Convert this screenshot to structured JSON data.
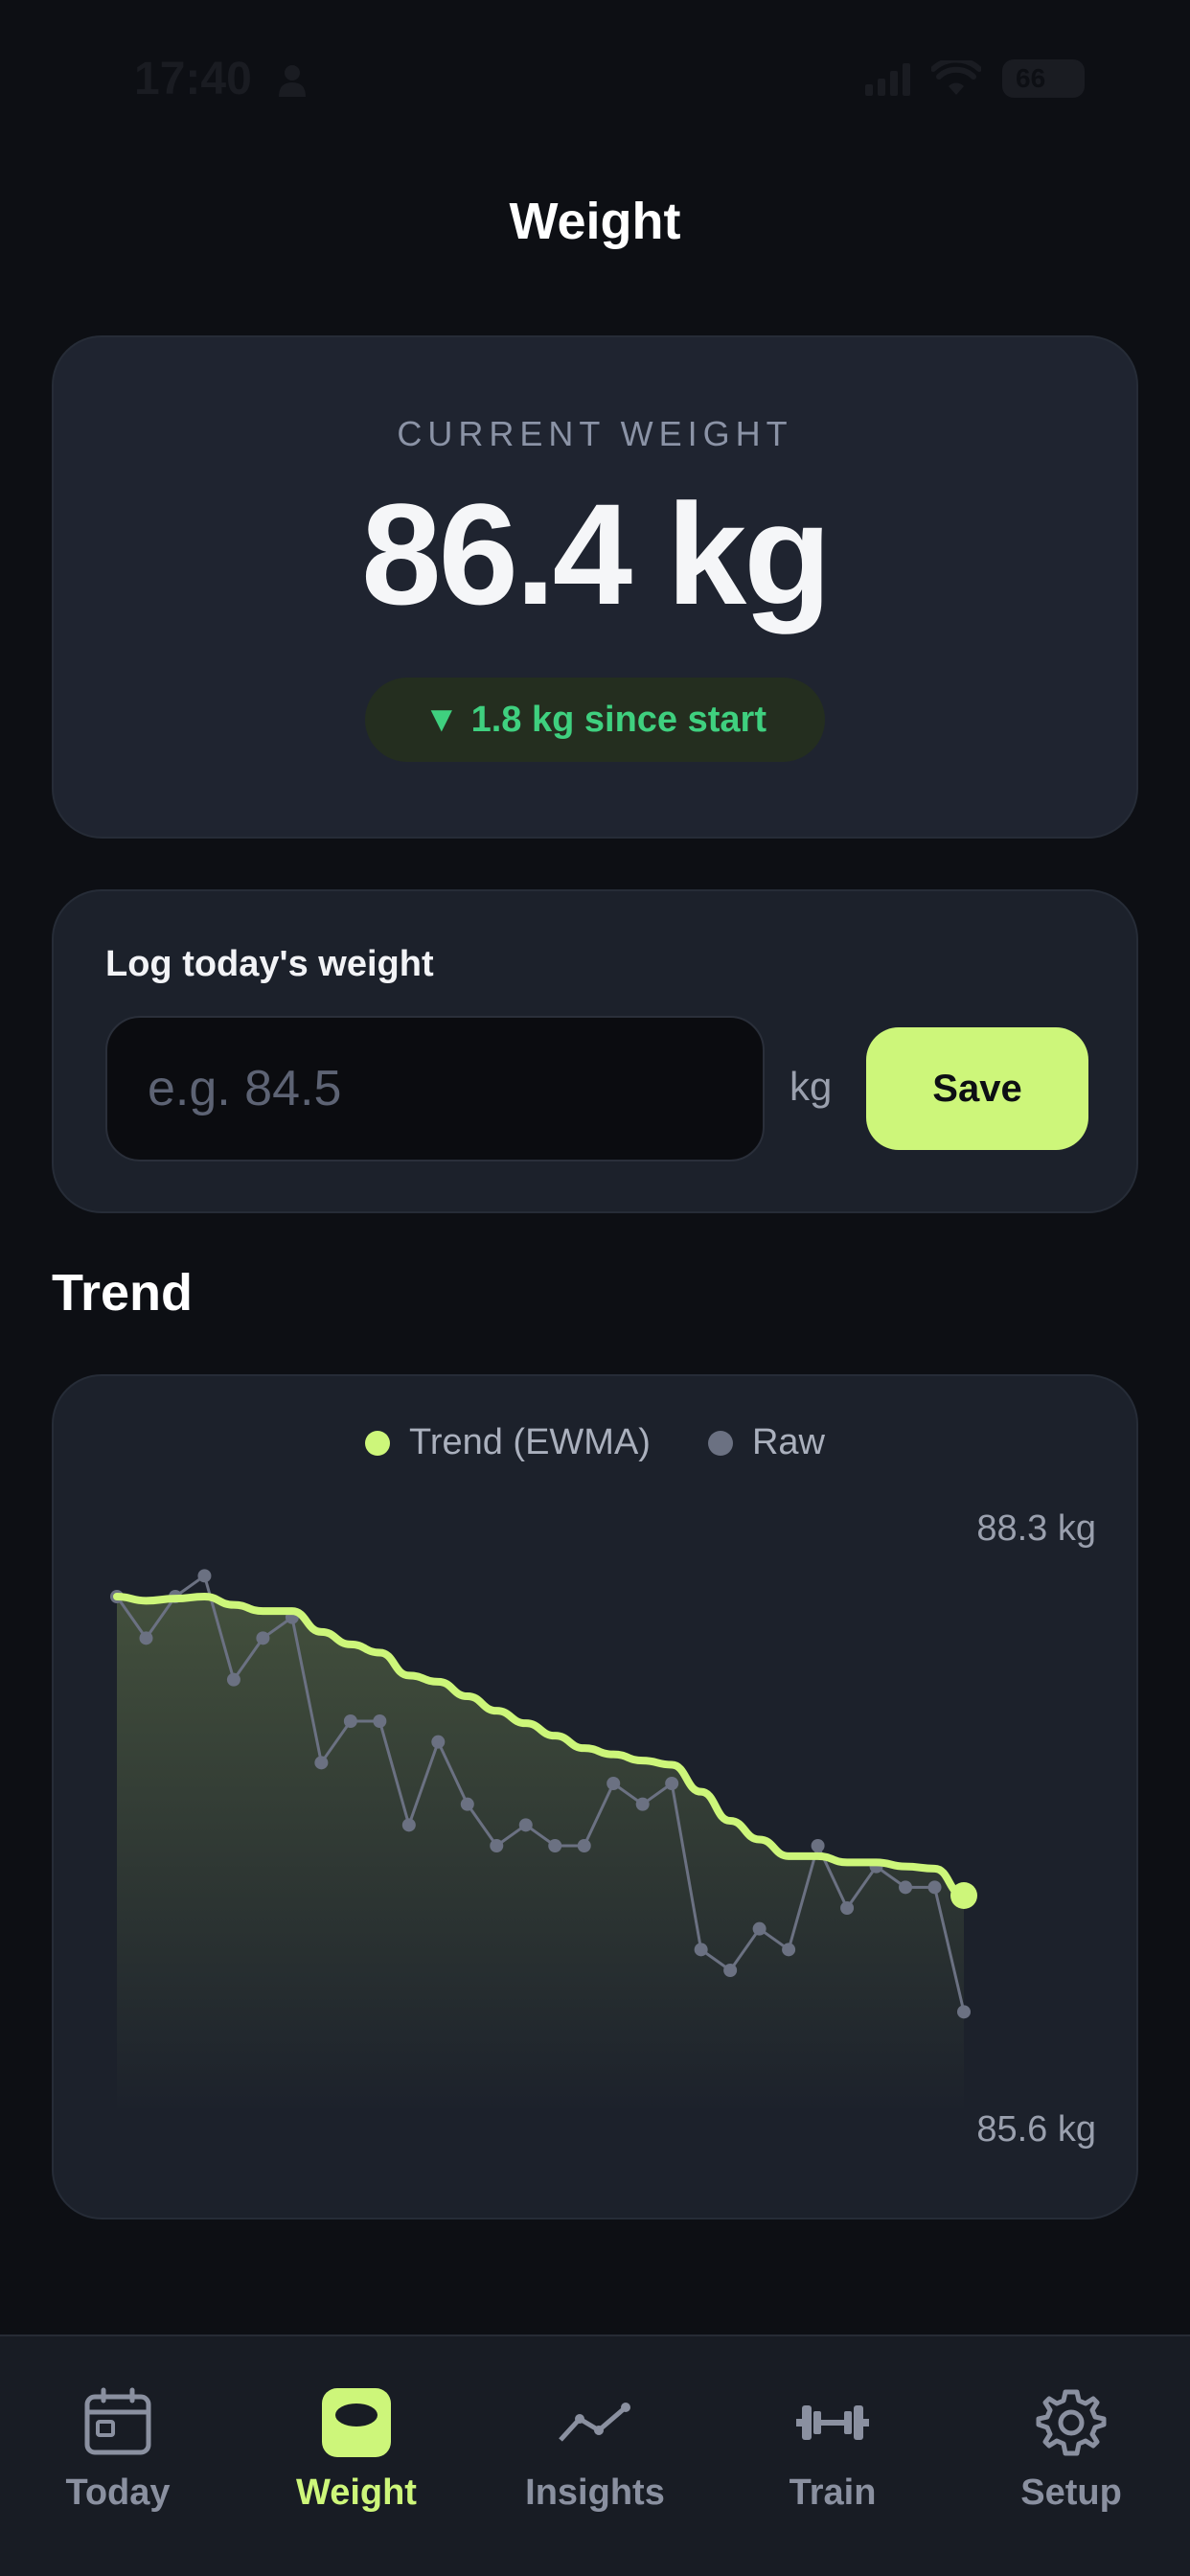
{
  "status_bar": {
    "time": "17:40",
    "battery": "66"
  },
  "page": {
    "title": "Weight"
  },
  "current": {
    "label": "CURRENT WEIGHT",
    "value": "86.4 kg",
    "delta_arrow": "▼",
    "delta_text": "1.8 kg since start"
  },
  "log": {
    "title": "Log today's weight",
    "input_value": "",
    "input_placeholder": "e.g. 84.5",
    "unit": "kg",
    "save_label": "Save"
  },
  "trend_section": {
    "title": "Trend"
  },
  "colors": {
    "accent": "#cdf67a",
    "raw": "#6b7182",
    "delta_good": "#3fd07f",
    "background": "#0d0f14",
    "card": "#1c212b"
  },
  "chart_data": {
    "type": "line",
    "legend": [
      "Trend (EWMA)",
      "Raw"
    ],
    "legend_position": "top-center",
    "ymax_label": "88.3 kg",
    "ymin_label": "85.6 kg",
    "ylim": [
      85.6,
      88.3
    ],
    "grid": false,
    "series": [
      {
        "name": "Raw",
        "values": [
          88.0,
          87.8,
          88.0,
          88.1,
          87.6,
          87.8,
          87.9,
          87.2,
          87.4,
          87.4,
          86.9,
          87.3,
          87.0,
          86.8,
          86.9,
          86.8,
          86.8,
          87.1,
          87.0,
          87.1,
          86.3,
          86.2,
          86.4,
          86.3,
          86.8,
          86.5,
          86.7,
          86.6,
          86.6,
          86.0
        ]
      },
      {
        "name": "Trend (EWMA)",
        "values": [
          88.0,
          87.98,
          87.99,
          88.0,
          87.96,
          87.93,
          87.93,
          87.83,
          87.77,
          87.73,
          87.62,
          87.59,
          87.52,
          87.45,
          87.39,
          87.33,
          87.27,
          87.24,
          87.21,
          87.19,
          87.06,
          86.92,
          86.83,
          86.75,
          86.75,
          86.72,
          86.72,
          86.7,
          86.69,
          86.56
        ]
      }
    ]
  },
  "tabs": [
    {
      "label": "Today",
      "icon": "calendar-icon",
      "active": false
    },
    {
      "label": "Weight",
      "icon": "kettlebell-icon",
      "active": true
    },
    {
      "label": "Insights",
      "icon": "trend-line-icon",
      "active": false
    },
    {
      "label": "Train",
      "icon": "dumbbell-icon",
      "active": false
    },
    {
      "label": "Setup",
      "icon": "gear-icon",
      "active": false
    }
  ]
}
